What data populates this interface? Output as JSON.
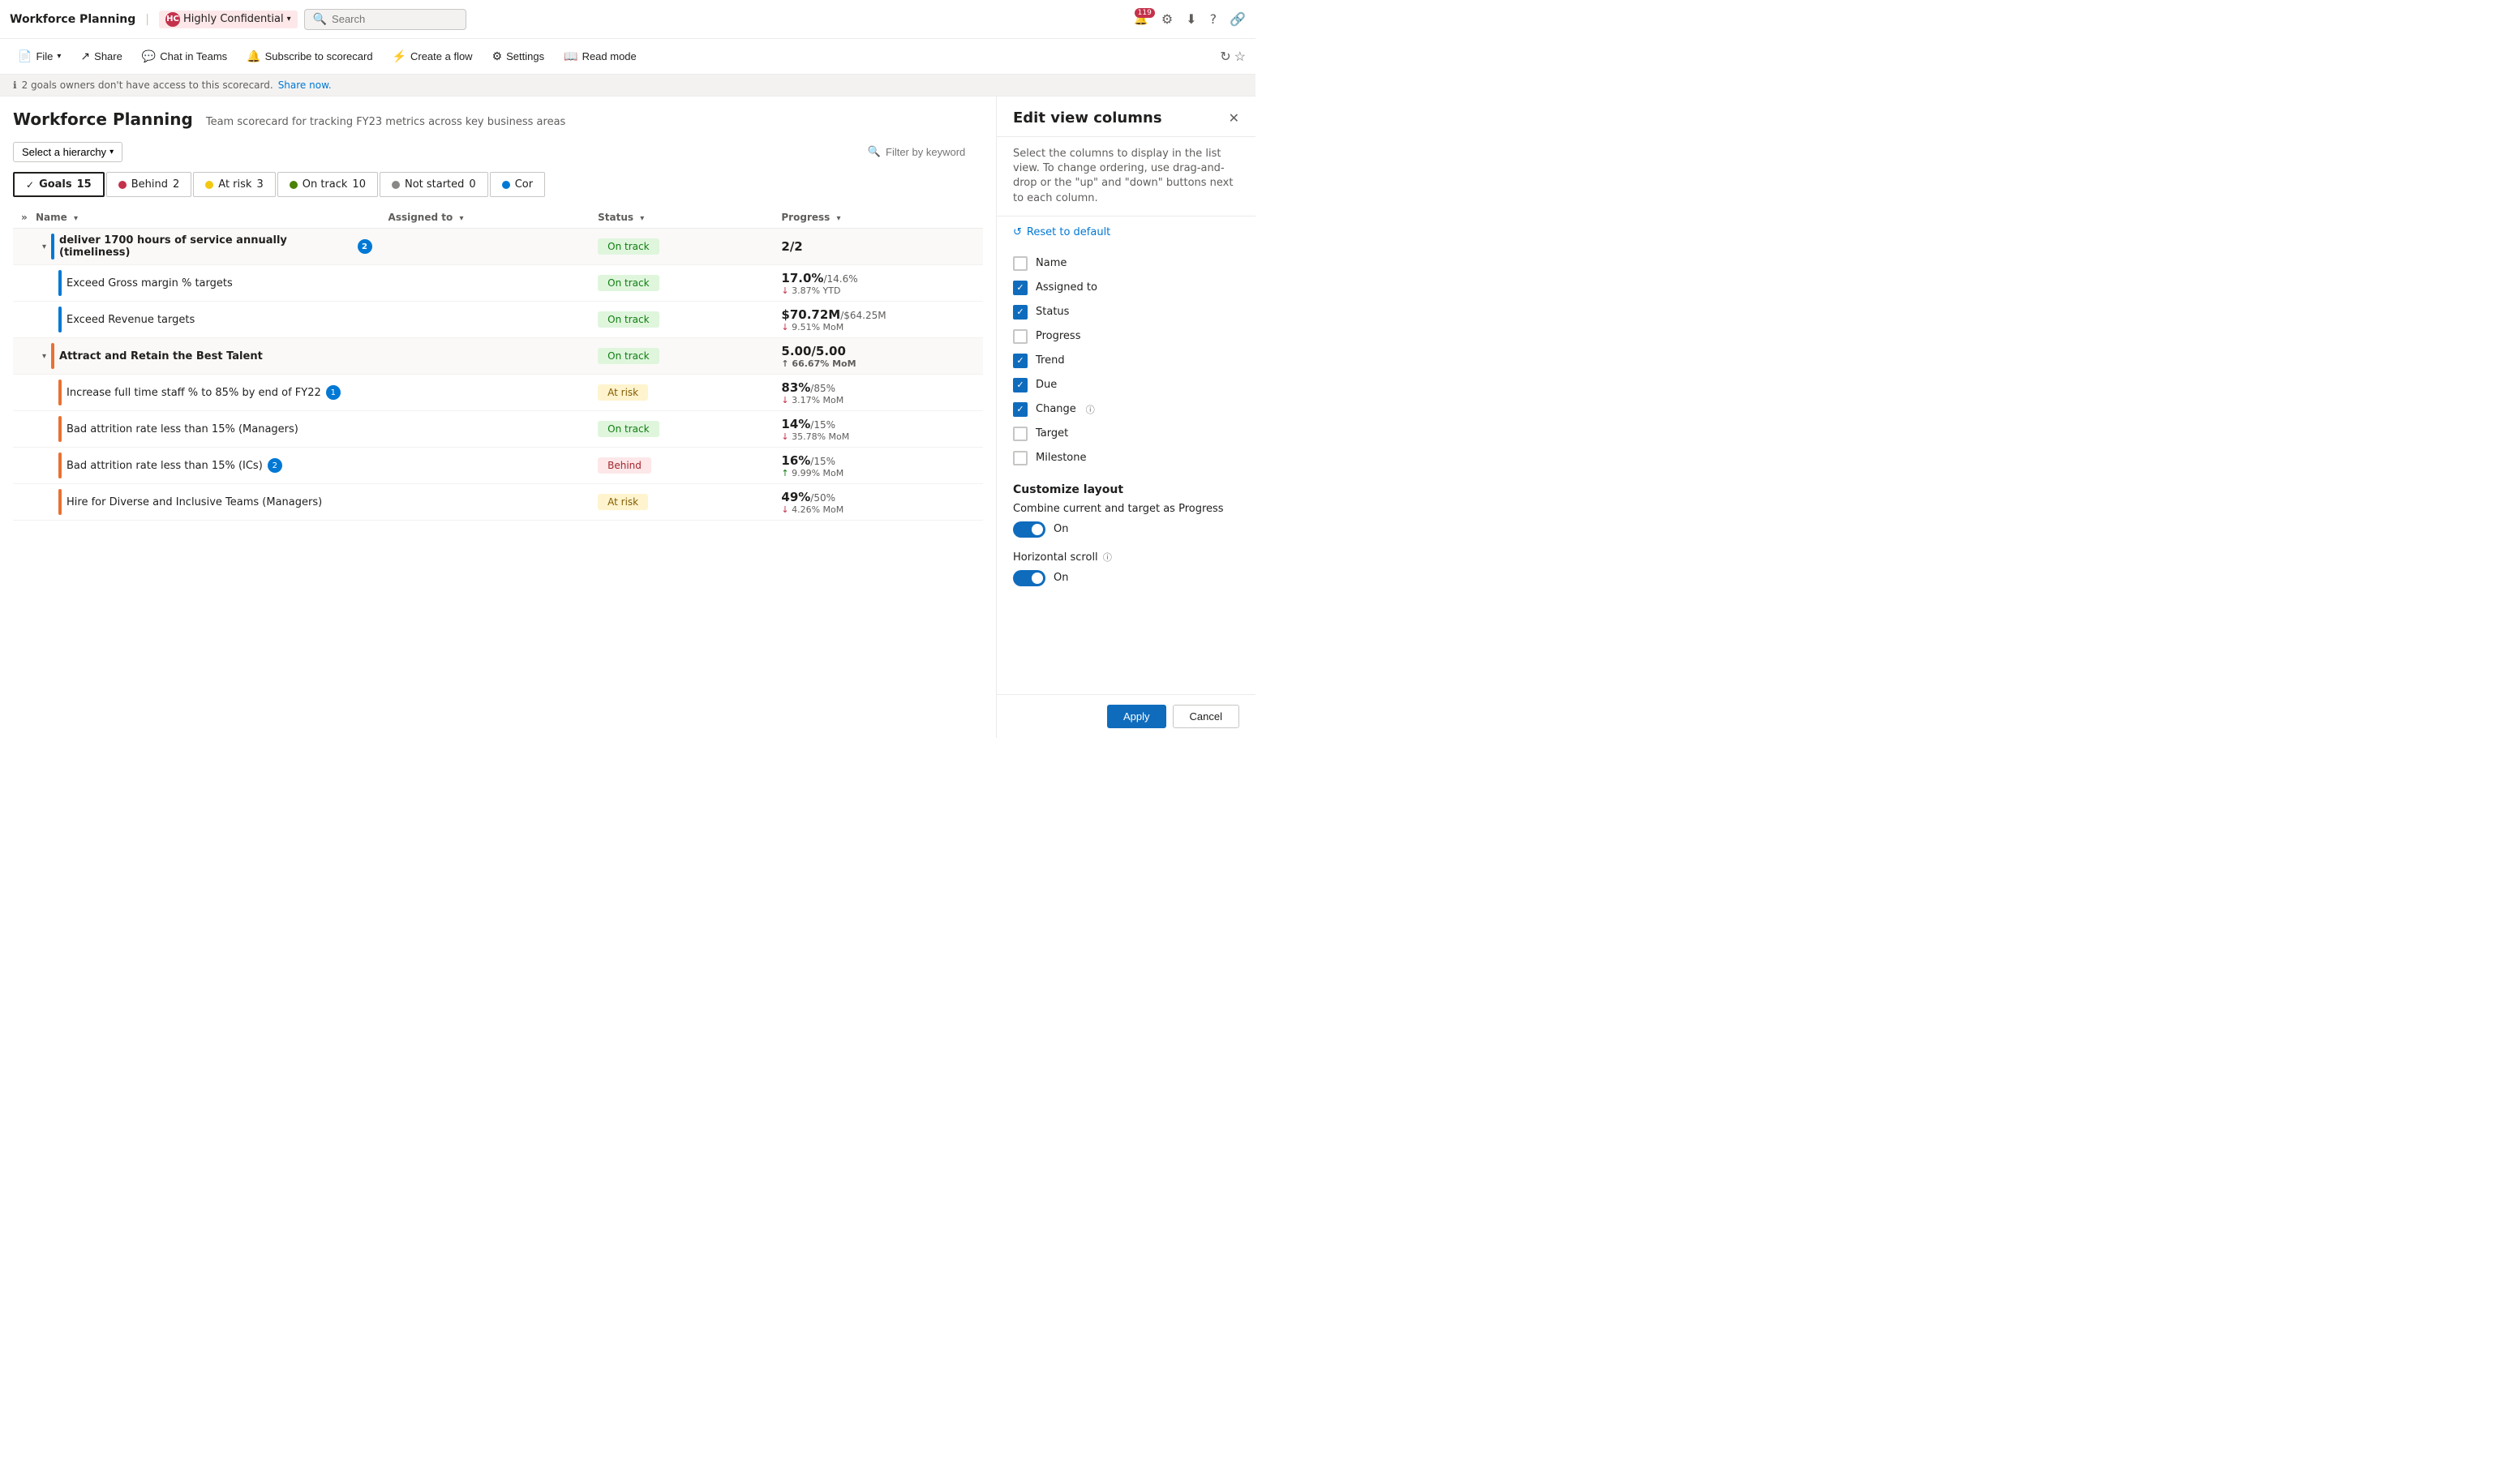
{
  "app": {
    "title": "Workforce Planning",
    "confidential": "Highly Confidential",
    "search_placeholder": "Search",
    "notification_count": "119"
  },
  "toolbar": {
    "file": "File",
    "share": "Share",
    "chat": "Chat in Teams",
    "subscribe": "Subscribe to scorecard",
    "create_flow": "Create a flow",
    "settings": "Settings",
    "read_mode": "Read mode"
  },
  "info_bar": {
    "message": "2 goals owners don't have access to this scorecard.",
    "link": "Share now."
  },
  "scorecard": {
    "title": "Workforce Planning",
    "subtitle": "Team scorecard for tracking FY23 metrics across key business areas",
    "hierarchy_label": "Select a hierarchy",
    "filter_placeholder": "Filter by keyword",
    "cols": {
      "name": "Name",
      "assigned": "Assigned to",
      "status": "Status",
      "progress": "Progress"
    }
  },
  "status_pills": [
    {
      "id": "goals",
      "label": "Goals",
      "count": "15",
      "active": true,
      "dot_class": "none",
      "icon": "✓"
    },
    {
      "id": "behind",
      "label": "Behind",
      "count": "2",
      "dot_class": "dot-behind"
    },
    {
      "id": "atrisk",
      "label": "At risk",
      "count": "3",
      "dot_class": "dot-atrisk"
    },
    {
      "id": "ontrack",
      "label": "On track",
      "count": "10",
      "dot_class": "dot-ontrack"
    },
    {
      "id": "notstarted",
      "label": "Not started",
      "count": "0",
      "dot_class": "dot-notstarted"
    },
    {
      "id": "completed",
      "label": "Cor",
      "count": "",
      "dot_class": "dot-completed"
    }
  ],
  "goals": [
    {
      "id": "g1",
      "name": "deliver 1700 hours of service annually (timeliness)",
      "assigned": "",
      "status": "On track",
      "status_class": "status-ontrack",
      "progress_main": "2/2",
      "progress_sub": "",
      "progress_arrow": "",
      "bar_class": "bar-blue",
      "level": "parent",
      "comments": 2,
      "children": [
        {
          "name": "Exceed Gross margin % targets",
          "status": "On track",
          "status_class": "status-ontrack",
          "progress_main": "17.0%",
          "progress_target": "/14.6%",
          "progress_sub": "↓ 3.87% YTD",
          "arrow": "down",
          "bar_class": "bar-blue",
          "comments": 0
        },
        {
          "name": "Exceed Revenue targets",
          "status": "On track",
          "status_class": "status-ontrack",
          "progress_main": "$70.72M",
          "progress_target": "/$64.25M",
          "progress_sub": "↓ 9.51% MoM",
          "arrow": "down",
          "bar_class": "bar-blue",
          "comments": 0
        }
      ]
    },
    {
      "id": "g2",
      "name": "Attract and Retain the Best Talent",
      "assigned": "",
      "status": "On track",
      "status_class": "status-ontrack",
      "progress_main": "5.00",
      "progress_target": "/5.00",
      "progress_sub": "↑ 66.67% MoM",
      "bar_class": "bar-orange",
      "level": "parent",
      "comments": 0,
      "children": [
        {
          "name": "Increase full time staff % to 85% by end of FY22",
          "status": "At risk",
          "status_class": "status-atrisk",
          "progress_main": "83%",
          "progress_target": "/85%",
          "progress_sub": "↓ 3.17% MoM",
          "arrow": "down",
          "bar_class": "bar-orange",
          "comments": 1
        },
        {
          "name": "Bad attrition rate less than 15% (Managers)",
          "status": "On track",
          "status_class": "status-ontrack",
          "progress_main": "14%",
          "progress_target": "/15%",
          "progress_sub": "↓ 35.78% MoM",
          "arrow": "down",
          "bar_class": "bar-orange",
          "comments": 0
        },
        {
          "name": "Bad attrition rate less than 15% (ICs)",
          "status": "Behind",
          "status_class": "status-behind",
          "progress_main": "16%",
          "progress_target": "/15%",
          "progress_sub": "↑ 9.99% MoM",
          "arrow": "up",
          "bar_class": "bar-orange",
          "comments": 2
        },
        {
          "name": "Hire for Diverse and Inclusive Teams (Managers)",
          "status": "At risk",
          "status_class": "status-atrisk",
          "progress_main": "49%",
          "progress_target": "/50%",
          "progress_sub": "↓ 4.26% MoM",
          "arrow": "down",
          "bar_class": "bar-orange",
          "comments": 0
        }
      ]
    }
  ],
  "edit_panel": {
    "title": "Edit view columns",
    "description": "Select the columns to display in the list view. To change ordering, use drag-and-drop or the \"up\" and \"down\" buttons next to each column.",
    "reset_label": "Reset to default",
    "columns": [
      {
        "id": "name",
        "label": "Name",
        "checked": false
      },
      {
        "id": "assigned",
        "label": "Assigned to",
        "checked": true
      },
      {
        "id": "status",
        "label": "Status",
        "checked": true
      },
      {
        "id": "progress",
        "label": "Progress",
        "checked": false
      },
      {
        "id": "trend",
        "label": "Trend",
        "checked": true
      },
      {
        "id": "due",
        "label": "Due",
        "checked": true
      },
      {
        "id": "change",
        "label": "Change",
        "checked": true,
        "info": true
      },
      {
        "id": "target",
        "label": "Target",
        "checked": false
      },
      {
        "id": "milestone",
        "label": "Milestone",
        "checked": false
      }
    ],
    "customize_title": "Customize layout",
    "combine_label": "Combine current and target as Progress",
    "combine_value": "On",
    "scroll_label": "Horizontal scroll",
    "scroll_info": true,
    "scroll_value": "On",
    "apply_label": "Apply",
    "cancel_label": "Cancel"
  }
}
